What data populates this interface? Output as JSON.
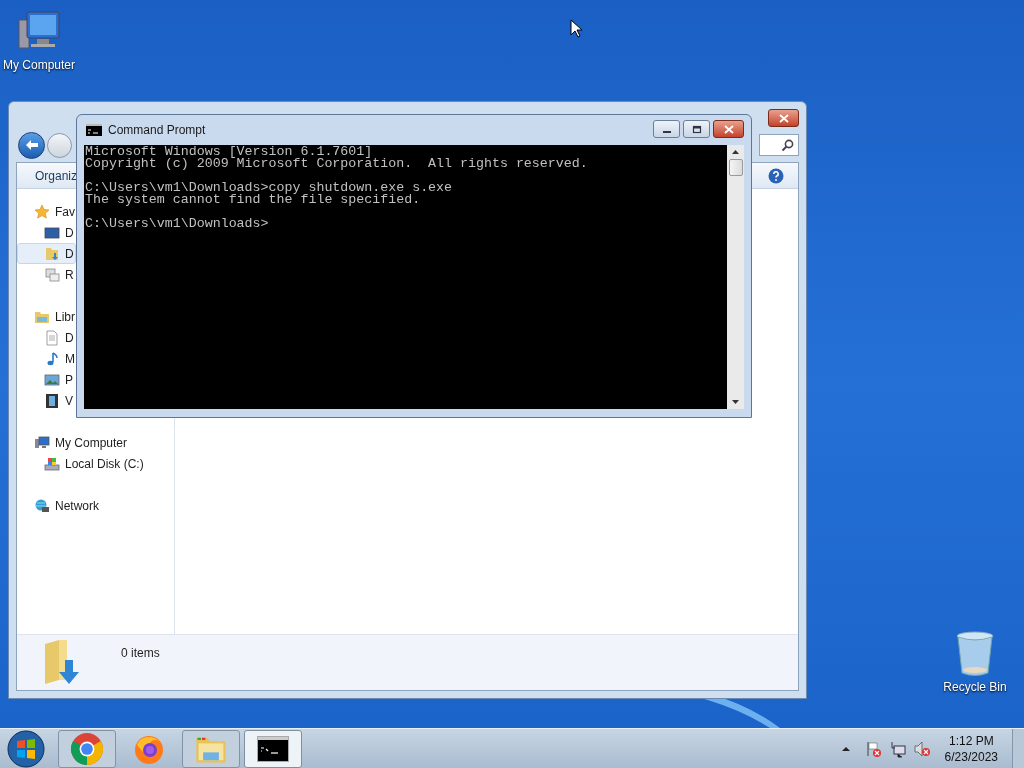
{
  "desktop_icons": [
    {
      "kind": "computer",
      "label": "My Computer"
    },
    {
      "kind": "recycle",
      "label": "Recycle Bin"
    }
  ],
  "explorer": {
    "toolbar": {
      "organize": "Organiz"
    },
    "nav": [
      {
        "kind": "favorites",
        "label": "Fav",
        "selected": false,
        "children": [
          {
            "kind": "desktop",
            "label": "D",
            "selected": false
          },
          {
            "kind": "downloads",
            "label": "D",
            "selected": true
          },
          {
            "kind": "recent",
            "label": "R",
            "selected": false
          }
        ]
      },
      {
        "kind": "libraries",
        "label": "Libr",
        "selected": false,
        "children": [
          {
            "kind": "documents",
            "label": "D",
            "selected": false
          },
          {
            "kind": "music",
            "label": "M",
            "selected": false
          },
          {
            "kind": "pictures",
            "label": "P",
            "selected": false
          },
          {
            "kind": "videos",
            "label": "V",
            "selected": false
          }
        ]
      },
      {
        "kind": "computer",
        "label": "My Computer",
        "selected": false,
        "children": [
          {
            "kind": "disk",
            "label": "Local Disk (C:)",
            "selected": false
          }
        ]
      },
      {
        "kind": "network",
        "label": "Network",
        "selected": false
      }
    ],
    "status": "0 items"
  },
  "cmd": {
    "title": "Command Prompt",
    "blocks": [
      [
        "Microsoft Windows [Version 6.1.7601]",
        "Copyright (c) 2009 Microsoft Corporation.  All rights reserved."
      ],
      [
        "C:\\Users\\vm1\\Downloads>copy shutdown.exe s.exe",
        "The system cannot find the file specified."
      ],
      [
        "C:\\Users\\vm1\\Downloads>"
      ]
    ]
  },
  "taskbar": {
    "buttons": [
      {
        "kind": "chrome",
        "running": true
      },
      {
        "kind": "firefox",
        "running": false
      },
      {
        "kind": "explorer",
        "running": true
      },
      {
        "kind": "cmd",
        "running": true
      }
    ],
    "tray": [
      {
        "kind": "flag"
      },
      {
        "kind": "network"
      },
      {
        "kind": "volume"
      }
    ],
    "time": "1:12 PM",
    "date": "6/23/2023"
  }
}
